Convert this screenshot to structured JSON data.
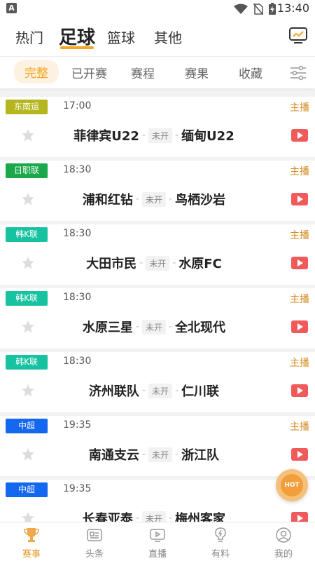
{
  "status_bar": {
    "app_letter": "A",
    "time": "13:40",
    "icons": [
      "wifi-icon",
      "no-sim-icon",
      "battery-charging-icon"
    ]
  },
  "top_tabs": [
    {
      "label": "热门",
      "active": false
    },
    {
      "label": "足球",
      "active": true
    },
    {
      "label": "篮球",
      "active": false
    },
    {
      "label": "其他",
      "active": false
    }
  ],
  "sub_tabs": [
    {
      "label": "完整",
      "active": true
    },
    {
      "label": "已开赛",
      "active": false
    },
    {
      "label": "赛程",
      "active": false
    },
    {
      "label": "赛果",
      "active": false
    },
    {
      "label": "收藏",
      "active": false
    }
  ],
  "matches": [
    {
      "league": "东南运",
      "league_color": "#b5b51d",
      "time": "17:00",
      "home": "菲律宾U22",
      "status": "未开",
      "away": "缅甸U22",
      "stream": "主播"
    },
    {
      "league": "日职联",
      "league_color": "#1aa84a",
      "time": "18:30",
      "home": "浦和红钻",
      "status": "未开",
      "away": "鸟栖沙岩",
      "stream": "主播"
    },
    {
      "league": "韩K联",
      "league_color": "#17c2a0",
      "time": "18:30",
      "home": "大田市民",
      "status": "未开",
      "away": "水原FC",
      "stream": "主播"
    },
    {
      "league": "韩K联",
      "league_color": "#17c2a0",
      "time": "18:30",
      "home": "水原三星",
      "status": "未开",
      "away": "全北现代",
      "stream": "主播"
    },
    {
      "league": "韩K联",
      "league_color": "#17c2a0",
      "time": "18:30",
      "home": "济州联队",
      "status": "未开",
      "away": "仁川联",
      "stream": "主播"
    },
    {
      "league": "中超",
      "league_color": "#1468f0",
      "time": "19:35",
      "home": "南通支云",
      "status": "未开",
      "away": "浙江队",
      "stream": "主播"
    },
    {
      "league": "中超",
      "league_color": "#1468f0",
      "time": "19:35",
      "home": "长春亚泰",
      "status": "未开",
      "away": "梅州客家",
      "stream": ""
    }
  ],
  "hot_button": {
    "label": "HOT"
  },
  "bottom_nav": [
    {
      "label": "赛事",
      "icon": "trophy-icon",
      "active": true
    },
    {
      "label": "头条",
      "icon": "news-icon",
      "active": false
    },
    {
      "label": "直播",
      "icon": "live-play-icon",
      "active": false
    },
    {
      "label": "有料",
      "icon": "lightbulb-icon",
      "active": false
    },
    {
      "label": "我的",
      "icon": "profile-icon",
      "active": false
    }
  ],
  "colors": {
    "accent": "#f5a623",
    "stream_text": "#d48a1e",
    "play_red": "#f05a5a"
  }
}
